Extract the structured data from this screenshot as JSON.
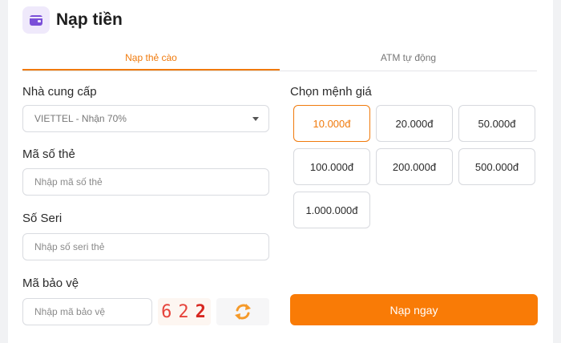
{
  "page": {
    "title": "Nạp tiền",
    "icon": "wallet-icon",
    "accent_color": "#f97b06"
  },
  "tabs": [
    {
      "label": "Nạp thẻ cào",
      "active": true
    },
    {
      "label": "ATM tự động",
      "active": false
    }
  ],
  "form": {
    "provider": {
      "label": "Nhà cung cấp",
      "selected": "VIETTEL - Nhận 70%"
    },
    "card_code": {
      "label": "Mã số thẻ",
      "placeholder": "Nhập mã số thẻ"
    },
    "serial": {
      "label": "Số Seri",
      "placeholder": "Nhập số seri thẻ"
    },
    "security": {
      "label": "Mã bảo vệ",
      "placeholder": "Nhập mã bảo vệ",
      "captcha": [
        "6",
        "2",
        "2"
      ]
    }
  },
  "denominations": {
    "label": "Chọn mệnh giá",
    "options": [
      "10.000đ",
      "20.000đ",
      "50.000đ",
      "100.000đ",
      "200.000đ",
      "500.000đ",
      "1.000.000đ"
    ],
    "selected": "10.000đ"
  },
  "submit_label": "Nạp ngay"
}
